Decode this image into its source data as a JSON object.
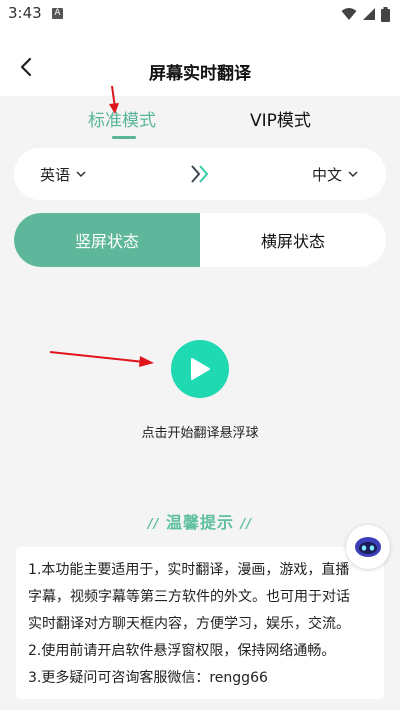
{
  "status_bar": {
    "time": "3:43",
    "notification_glyph": "A"
  },
  "header": {
    "title": "屏幕实时翻译",
    "back_icon": "back-chevron-icon"
  },
  "tabs": [
    {
      "label": "标准模式",
      "active": true
    },
    {
      "label": "VIP模式",
      "active": false
    }
  ],
  "language": {
    "source": "英语",
    "target": "中文",
    "swap_icon": "double-chevron-right-icon"
  },
  "orientation": {
    "portrait": "竖屏状态",
    "landscape": "横屏状态",
    "selected": "portrait"
  },
  "start": {
    "caption": "点击开始翻译悬浮球"
  },
  "tips": {
    "title": "温馨提示",
    "lines": [
      "1.本功能主要适用于，实时翻译，漫画，游戏，直播",
      "字幕，视频字幕等第三方软件的外文。也可用于对话",
      "实时翻译对方聊天框内容，方便学习，娱乐，交流。",
      "2.使用前请开启软件悬浮窗权限，保持网络通畅。",
      "3.更多疑问可咨询客服微信：rengg66"
    ]
  },
  "colors": {
    "accent": "#58b59a",
    "toggle_active": "#5fb79b",
    "play_button": "#1ed9b2",
    "annotation_arrow": "#e0151b"
  }
}
